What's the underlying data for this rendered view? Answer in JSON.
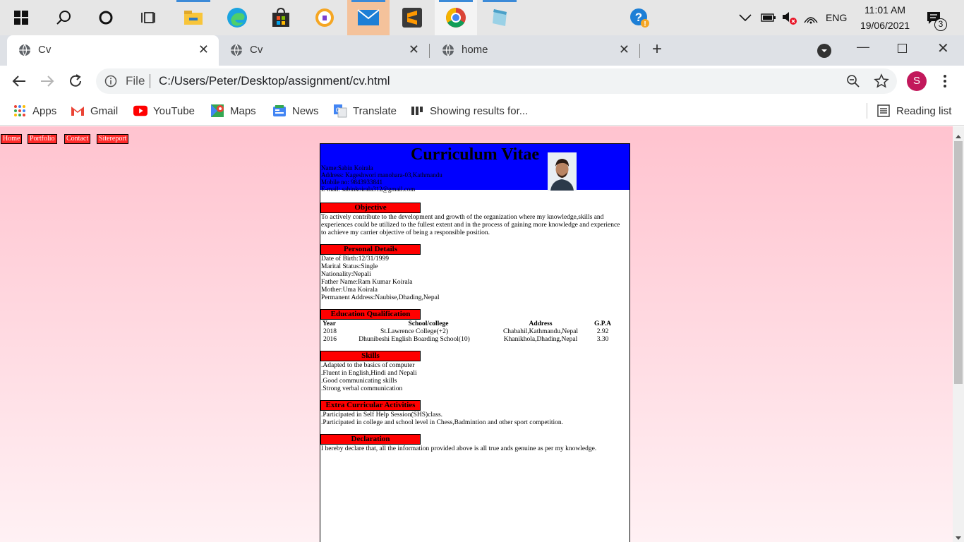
{
  "taskbar": {
    "language": "ENG",
    "time": "11:01 AM",
    "date": "19/06/2021",
    "notification_count": "3"
  },
  "tabs": [
    {
      "label": "Cv"
    },
    {
      "label": "Cv"
    },
    {
      "label": "home"
    }
  ],
  "toolbar": {
    "file_label": "File",
    "url": "C:/Users/Peter/Desktop/assignment/cv.html",
    "profile_initial": "S"
  },
  "bookmarks": {
    "items": [
      {
        "label": "Apps",
        "icon": "apps-grid-icon"
      },
      {
        "label": "Gmail",
        "icon": "gmail-icon"
      },
      {
        "label": "YouTube",
        "icon": "youtube-icon"
      },
      {
        "label": "Maps",
        "icon": "maps-icon"
      },
      {
        "label": "News",
        "icon": "news-icon"
      },
      {
        "label": "Translate",
        "icon": "translate-icon"
      },
      {
        "label": "Showing results for...",
        "icon": "bookmark-site-icon"
      }
    ],
    "reading_list": "Reading list"
  },
  "page": {
    "nav": [
      "Home",
      "Portfolio",
      "Contact",
      "Sitereport"
    ],
    "title": "Curriculum Vitae",
    "header_lines": [
      "Name:Sabin Koirala",
      "Address: Kageshwori manohara-03,Kathmandu",
      "Mobile no: 9843933841",
      "E-mail: sabinkoirala312@gmail.com"
    ],
    "objective": {
      "title": "Objective",
      "text": "To actively contribute to the development and growth of the organization where my knowledge,skills and experiences could be utilized to the fullest extent and in the process of gaining more knowledge and experience to achieve my carrier objective of being a responsible position."
    },
    "personal": {
      "title": "Personal Details",
      "lines": [
        "Date of Birth:12/31/1999",
        "Marital Status:Single",
        "Nationality:Nepali",
        "Father Name:Ram Kumar Koirala",
        "Mother:Uma Koirala",
        "Permanent Address:Naubise,Dhading,Nepal"
      ]
    },
    "education": {
      "title": "Education Qualification",
      "headers": [
        "Year",
        "School/college",
        "Address",
        "G.P.A"
      ],
      "rows": [
        [
          "2018",
          "St.Lawrence College(+2)",
          "Chabahil,Kathmandu,Nepal",
          "2.92"
        ],
        [
          "2016",
          "Dhunibeshi English Boarding School(10)",
          "Khanikhola,Dhading,Nepal",
          "3.30"
        ]
      ]
    },
    "skills": {
      "title": "Skills",
      "lines": [
        ".Adapted to the basics of computer",
        ".Fluent in English,Hindi and Nepali",
        ".Good communicating skills",
        ".Strong verbal communication"
      ]
    },
    "extra": {
      "title": "Extra Curricular Activities",
      "lines": [
        ".Participated in Self Help Session(SHS)class.",
        ".Participated in college and school level in Chess,Badmintion and other sport competition."
      ]
    },
    "declaration": {
      "title": "Declaration",
      "text": "I hereby declare that, all the information provided above is all true ands genuine as per my knowledge."
    }
  }
}
